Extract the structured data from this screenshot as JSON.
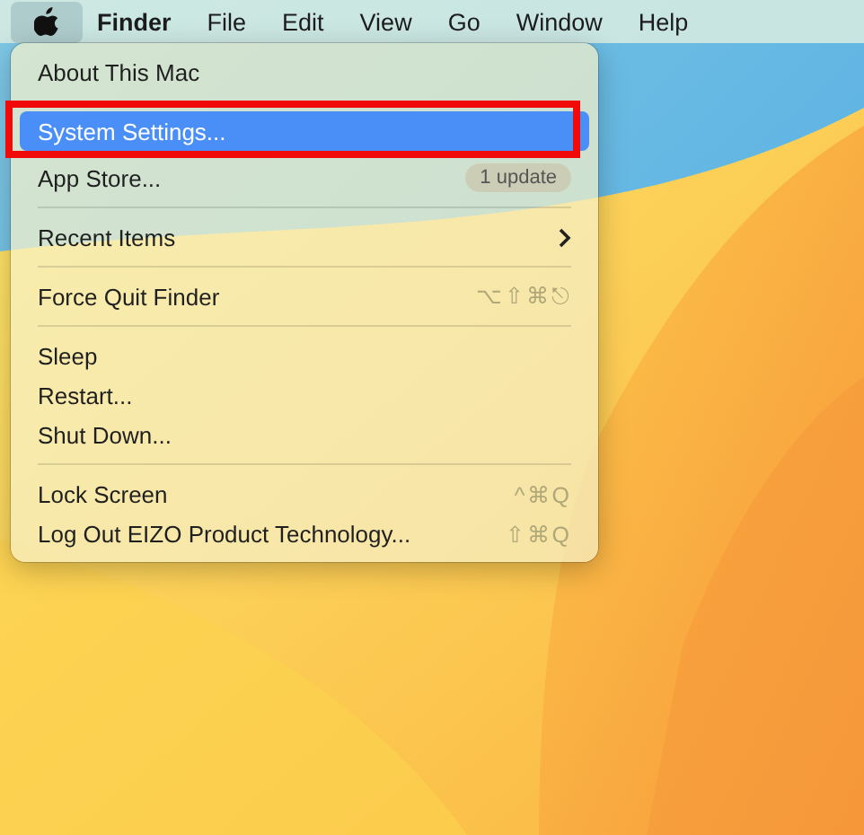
{
  "menu_bar": {
    "apple_menu": {
      "selected": true
    },
    "items": [
      {
        "label": "Finder",
        "kind": "app"
      },
      {
        "label": "File",
        "kind": "menu"
      },
      {
        "label": "Edit",
        "kind": "menu"
      },
      {
        "label": "View",
        "kind": "menu"
      },
      {
        "label": "Go",
        "kind": "menu"
      },
      {
        "label": "Window",
        "kind": "menu"
      },
      {
        "label": "Help",
        "kind": "menu"
      }
    ]
  },
  "apple_menu": {
    "items": [
      {
        "kind": "item",
        "label": "About This Mac",
        "selected": false
      },
      {
        "kind": "separator"
      },
      {
        "kind": "item",
        "label": "System Settings...",
        "selected": true,
        "annotated": true
      },
      {
        "kind": "item",
        "label": "App Store...",
        "selected": false,
        "badge": "1 update"
      },
      {
        "kind": "separator"
      },
      {
        "kind": "submenu",
        "label": "Recent Items",
        "selected": false
      },
      {
        "kind": "separator"
      },
      {
        "kind": "item",
        "label": "Force Quit Finder",
        "selected": false,
        "shortcut": "⌥⇧⌘⎋"
      },
      {
        "kind": "separator"
      },
      {
        "kind": "item",
        "label": "Sleep",
        "selected": false
      },
      {
        "kind": "item",
        "label": "Restart...",
        "selected": false
      },
      {
        "kind": "item",
        "label": "Shut Down...",
        "selected": false
      },
      {
        "kind": "separator"
      },
      {
        "kind": "item",
        "label": "Lock Screen",
        "selected": false,
        "shortcut": "^⌘Q"
      },
      {
        "kind": "item",
        "label": "Log Out EIZO Product Technology...",
        "selected": false,
        "shortcut": "⇧⌘Q"
      }
    ]
  }
}
